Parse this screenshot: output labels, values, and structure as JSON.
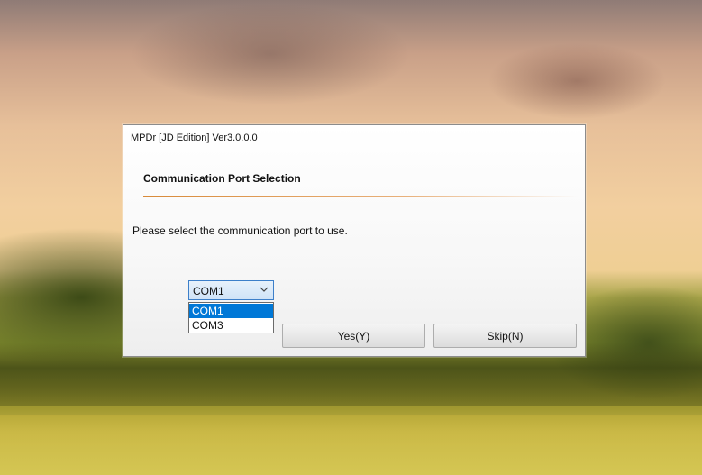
{
  "window": {
    "title": "MPDr [JD Edition] Ver3.0.0.0"
  },
  "heading": "Communication Port Selection",
  "prompt": "Please select the communication port to use.",
  "port_select": {
    "selected": "COM1",
    "options": [
      "COM1",
      "COM3"
    ],
    "highlighted": "COM1"
  },
  "buttons": {
    "yes": "Yes(Y)",
    "skip": "Skip(N)"
  },
  "colors": {
    "accent_rule": "#d88a39",
    "selection": "#0078d7",
    "combo_border": "#3d7fc9"
  },
  "icons": {
    "combo_arrow": "chevron-down-icon"
  }
}
